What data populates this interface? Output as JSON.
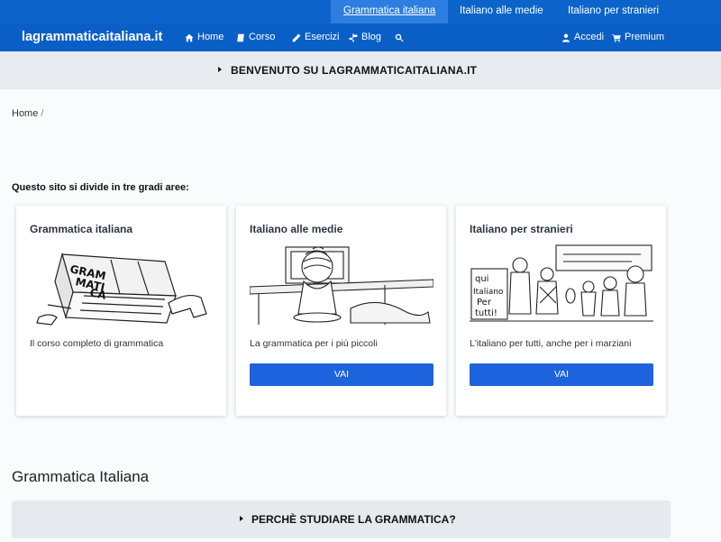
{
  "top_links": [
    "Grammatica italiana",
    "Italiano alle medie",
    "Italiano per stranieri"
  ],
  "nav": {
    "brand": "lagrammaticaitaliana.it",
    "home": "Home",
    "corso": "Corso",
    "esercizi": "Esercizi",
    "blog": "Blog",
    "accedi": "Accedi",
    "premium": "Premium"
  },
  "welcome": "BENVENUTO SU LAGRAMMATICAITALIANA.IT",
  "breadcrumb": {
    "home": "Home",
    "sep": "/"
  },
  "intro": "Questo sito si divide in tre gradi aree:",
  "cards": [
    {
      "title": "Grammatica italiana",
      "desc": "Il corso completo di grammatica",
      "art_text": "GRAM MATI CA"
    },
    {
      "title": "Italiano alle medie",
      "desc": "La grammatica per i più piccoli",
      "button": "VAI"
    },
    {
      "title": "Italiano per stranieri",
      "desc": "L'italiano per tutti, anche per i marziani",
      "button": "VAI",
      "art_text": "qui Italiano Per tutti!"
    }
  ],
  "section_title": "Grammatica Italiana",
  "accordion": "PERCHÈ STUDIARE LA GRAMMATICA?"
}
